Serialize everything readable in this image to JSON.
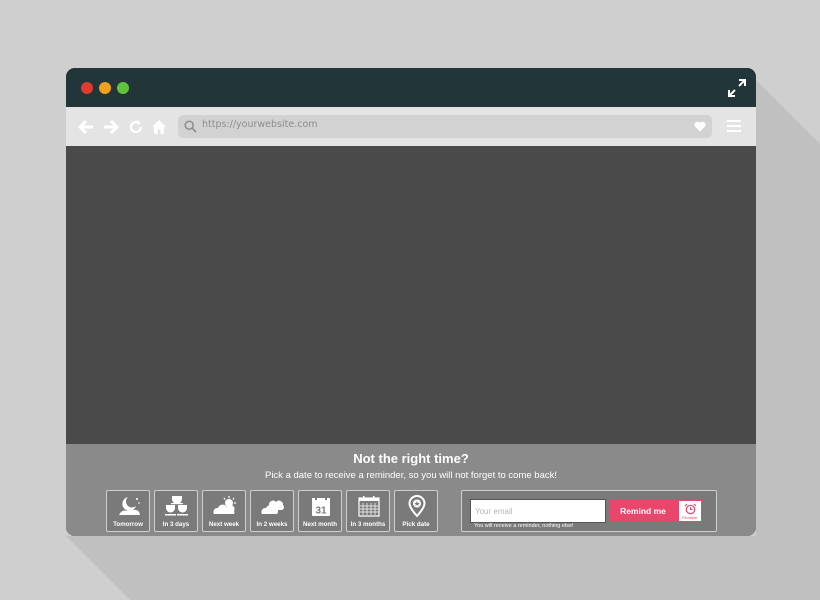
{
  "browser": {
    "url": "https://yourwebsite.com",
    "icons": [
      "back-arrow-icon",
      "forward-arrow-icon",
      "reload-icon",
      "home-icon",
      "search-icon",
      "heart-icon",
      "menu-icon",
      "expand-icon"
    ],
    "colors": {
      "titlebar": "#223538",
      "toolbar": "#e4e4e4",
      "viewport": "#4a4a4a",
      "footer": "#8a8a8a",
      "accent": "#e8466b"
    }
  },
  "reminder": {
    "title": "Not the right time?",
    "subtitle": "Pick a date to receive a reminder, so you will not forget to come back!",
    "options": [
      {
        "label": "Tomorrow",
        "icon": "moon-night-icon"
      },
      {
        "label": "In 3 days",
        "icon": "cups-icon"
      },
      {
        "label": "Next week",
        "icon": "sun-cloud-icon"
      },
      {
        "label": "In 2 weeks",
        "icon": "clouds-icon"
      },
      {
        "label": "Next month",
        "icon": "calendar-31-icon"
      },
      {
        "label": "In 3 months",
        "icon": "calendar-grid-icon"
      },
      {
        "label": "Pick date",
        "icon": "location-pin-icon"
      }
    ],
    "email_placeholder": "Your email",
    "button_label": "Remind me",
    "alarm_caption": "Reminder",
    "note": "You will receive a reminder, nothing else!"
  }
}
